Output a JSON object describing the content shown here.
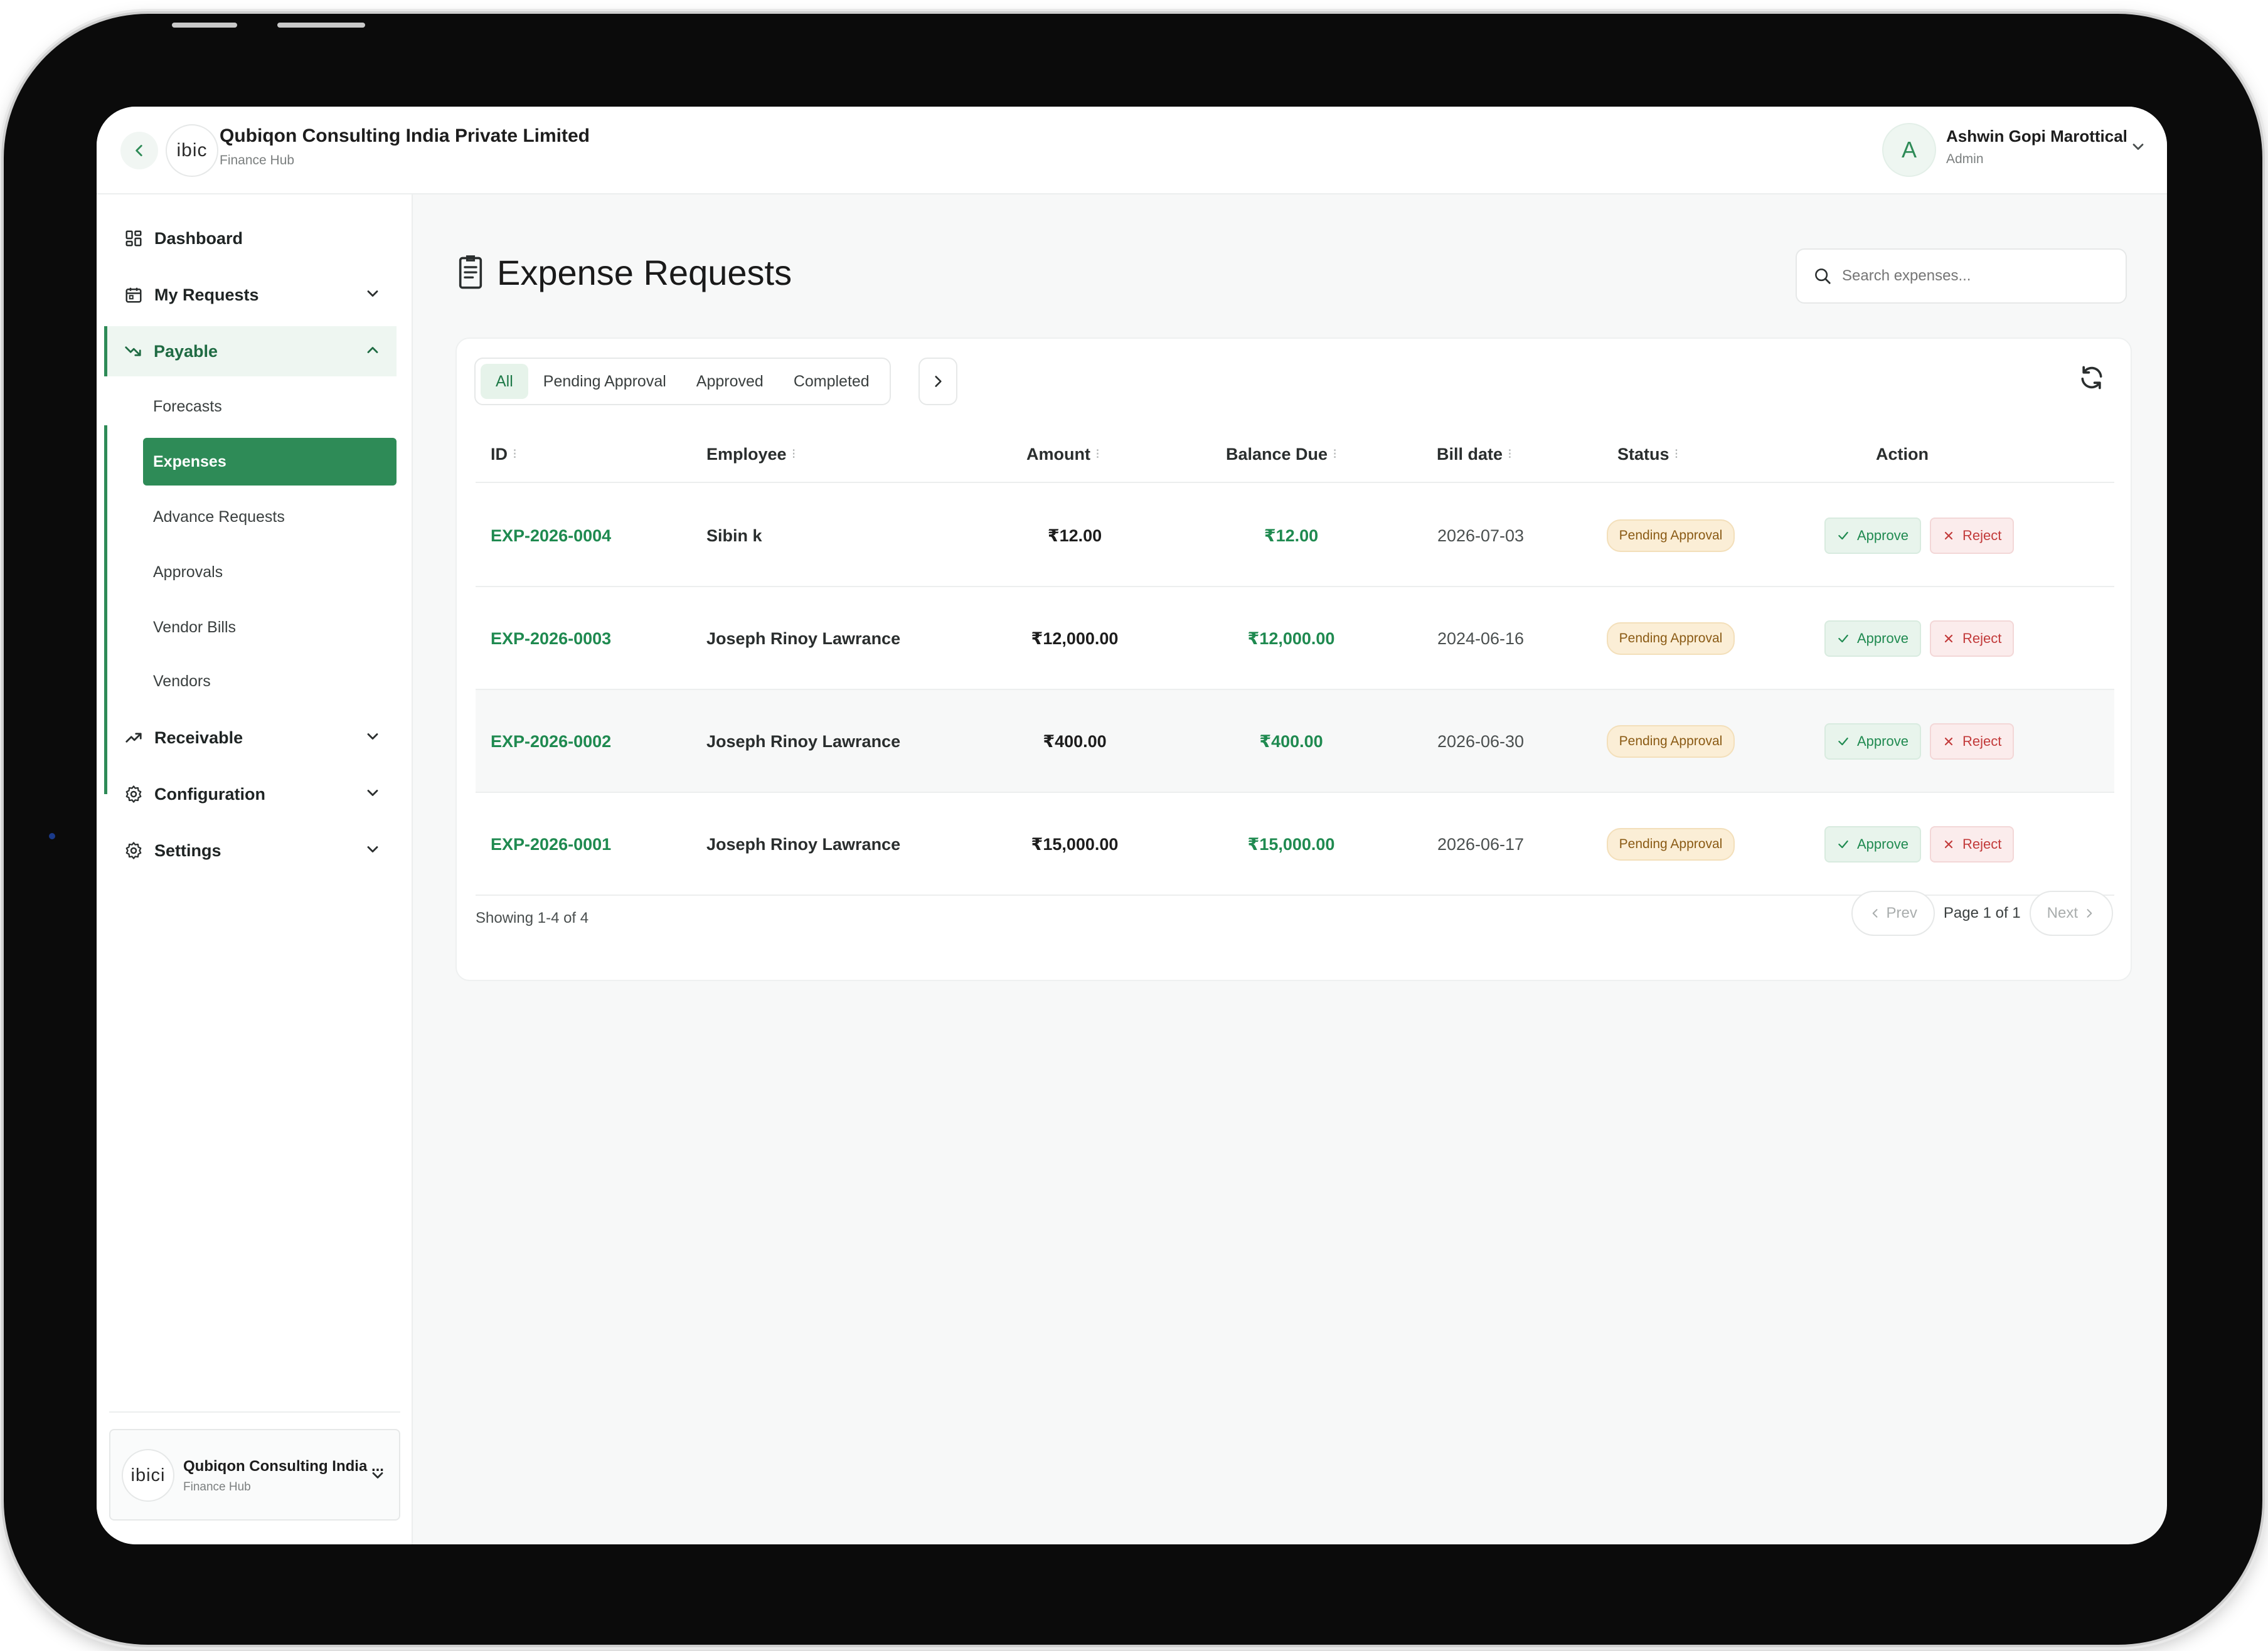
{
  "header": {
    "company_name": "Qubiqon Consulting India Private Limited",
    "company_sub": "Finance Hub",
    "logo_text": "ibic",
    "user_initial": "A",
    "user_name": "Ashwin Gopi Marottical",
    "user_role": "Admin"
  },
  "sidebar": {
    "items": [
      {
        "label": "Dashboard",
        "icon": "grid-icon"
      },
      {
        "label": "My Requests",
        "icon": "calendar-icon"
      },
      {
        "label": "Payable",
        "icon": "trend-down-icon"
      },
      {
        "label": "Receivable",
        "icon": "trend-up-icon"
      },
      {
        "label": "Configuration",
        "icon": "gear-icon"
      },
      {
        "label": "Settings",
        "icon": "gear-icon"
      }
    ],
    "payable_sub": [
      "Forecasts",
      "Expenses",
      "Advance Requests",
      "Approvals",
      "Vendor Bills",
      "Vendors"
    ],
    "active_sub": "Expenses",
    "org_card": {
      "logo_text": "ibici",
      "name": "Qubiqon Consulting India ...",
      "sub": "Finance Hub"
    }
  },
  "main": {
    "title": "Expense Requests",
    "search_placeholder": "Search expenses...",
    "tabs": [
      "All",
      "Pending Approval",
      "Approved",
      "Completed"
    ],
    "active_tab": "All",
    "columns": [
      "ID",
      "Employee",
      "Amount",
      "Balance Due",
      "Bill date",
      "Status",
      "Action"
    ],
    "rows": [
      {
        "id": "EXP-2026-0004",
        "employee": "Sibin k",
        "amount": "₹12.00",
        "balance": "₹12.00",
        "date": "2026-07-03",
        "status": "Pending Approval"
      },
      {
        "id": "EXP-2026-0003",
        "employee": "Joseph Rinoy Lawrance",
        "amount": "₹12,000.00",
        "balance": "₹12,000.00",
        "date": "2024-06-16",
        "status": "Pending Approval"
      },
      {
        "id": "EXP-2026-0002",
        "employee": "Joseph Rinoy Lawrance",
        "amount": "₹400.00",
        "balance": "₹400.00",
        "date": "2026-06-30",
        "status": "Pending Approval"
      },
      {
        "id": "EXP-2026-0001",
        "employee": "Joseph Rinoy Lawrance",
        "amount": "₹15,000.00",
        "balance": "₹15,000.00",
        "date": "2026-06-17",
        "status": "Pending Approval"
      }
    ],
    "approve_label": "Approve",
    "reject_label": "Reject",
    "showing": "Showing 1-4 of 4",
    "prev_label": "Prev",
    "next_label": "Next",
    "page_label": "Page 1 of 1"
  },
  "colors": {
    "accent": "#2e8b57",
    "badge_bg": "#fbeed6",
    "reject": "#c23a3a"
  }
}
